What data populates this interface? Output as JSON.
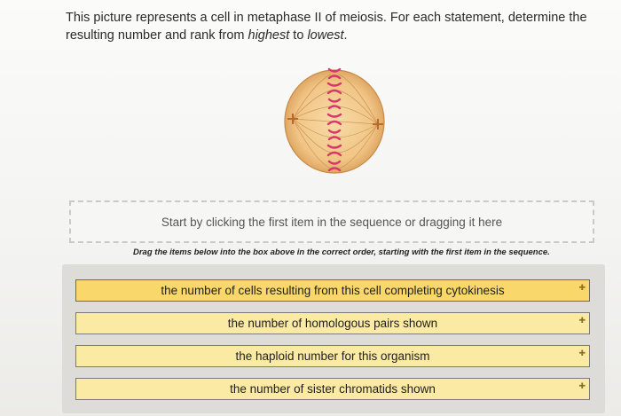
{
  "question": {
    "part1": "This picture represents a cell in metaphase II of meiosis. For each statement, determine the resulting number and rank from ",
    "highest": "highest",
    "to": " to ",
    "lowest": "lowest",
    "end": "."
  },
  "drop_zone": {
    "placeholder": "Start by clicking the first item in the sequence or dragging it here"
  },
  "instruction": "Drag the items below into the box above in the correct order, starting with the first item in the sequence.",
  "items": [
    {
      "label": "the number of cells resulting from this cell completing cytokinesis"
    },
    {
      "label": "the number of homologous pairs shown"
    },
    {
      "label": "the haploid number for this organism"
    },
    {
      "label": "the number of sister chromatids shown"
    }
  ],
  "colors": {
    "item_fill": "#fbeaa4",
    "item_first_fill": "#fad76b",
    "cell_fill": "#f3c98c",
    "chromosome": "#d8356b"
  },
  "icons": {
    "item_handle": "plus-icon"
  }
}
